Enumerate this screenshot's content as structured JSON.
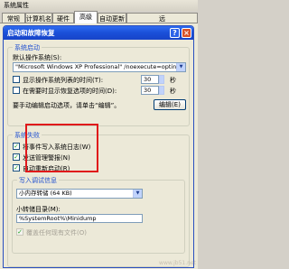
{
  "outer_window": {
    "title": "系统属性",
    "tabs": [
      {
        "label": "常规"
      },
      {
        "label": "计算机名"
      },
      {
        "label": "硬件"
      },
      {
        "label": "高级"
      },
      {
        "label": "自动更新"
      },
      {
        "label": "远"
      }
    ]
  },
  "dialog": {
    "title": "启动和故障恢复",
    "help_glyph": "?",
    "close_glyph": "×",
    "startup": {
      "group_label": "系统启动",
      "default_os_label": "默认操作系统(S):",
      "default_os_value": "\"Microsoft Windows XP Professional\" /noexecute=optin",
      "show_os_list_label": "显示操作系统列表的时间(T):",
      "show_os_list_value": "30",
      "show_recovery_label": "在需要时显示恢复选项的时间(D):",
      "show_recovery_value": "30",
      "seconds": "秒",
      "edit_hint": "要手动编辑启动选项，请单击“编辑”。",
      "edit_button": "编辑(E)"
    },
    "failure": {
      "group_label": "系统失败",
      "write_event_label": "将事件写入系统日志(W)",
      "send_alert_label": "发送管理警报(N)",
      "auto_restart_label": "自动重新启动(R)",
      "debug_group_label": "写入调试信息",
      "debug_select_value": "小内存转储 (64 KB)",
      "dump_dir_label": "小转储目录(M):",
      "dump_dir_value": "%SystemRoot%\\Minidump",
      "overwrite_label": "覆盖任何现有文件(O)"
    }
  },
  "watermark": "www.jb51.net"
}
